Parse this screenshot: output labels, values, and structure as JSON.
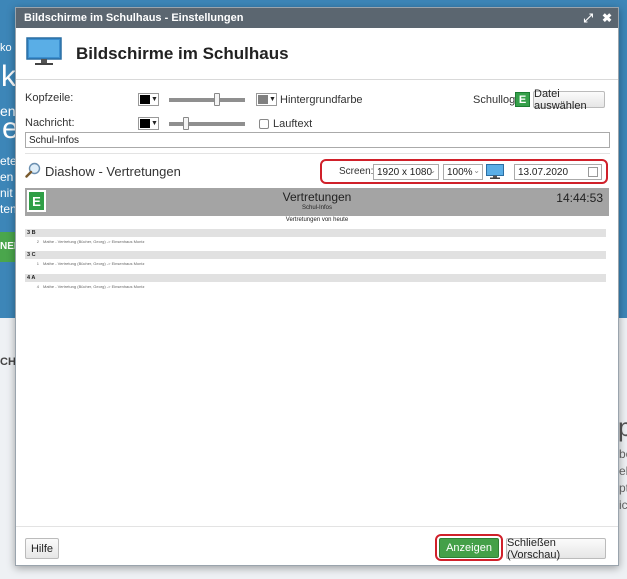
{
  "background": {
    "fragments": [
      {
        "id": "bg-ko",
        "text": "ko"
      },
      {
        "id": "bg-k",
        "text": "k"
      },
      {
        "id": "bg-en",
        "text": "en"
      },
      {
        "id": "bg-e",
        "text": "e"
      },
      {
        "id": "bg-er",
        "text": "er"
      },
      {
        "id": "bg-ete",
        "text": "ete"
      },
      {
        "id": "bg-en2",
        "text": "en"
      },
      {
        "id": "bg-nit",
        "text": "nit"
      },
      {
        "id": "bg-ten",
        "text": "ten"
      },
      {
        "id": "bg-ch",
        "text": "CH"
      },
      {
        "id": "bg-p",
        "text": "p"
      },
      {
        "id": "bg-be",
        "text": "be"
      },
      {
        "id": "bg-ek",
        "text": "ek"
      },
      {
        "id": "bg-pti",
        "text": "pti"
      },
      {
        "id": "bg-ic",
        "text": "ic"
      }
    ],
    "green_button": "NEN"
  },
  "dialog": {
    "window_title": "Bildschirme im Schulhaus - Einstellungen",
    "header_title": "Bildschirme im Schulhaus",
    "kopfzeile_label": "Kopfzeile:",
    "hintergrundfarbe_label": "Hintergrundfarbe",
    "schullogo_label": "Schullogo:",
    "datei_button": "Datei auswählen",
    "nachricht_label": "Nachricht:",
    "lauftext_label": "Lauftext",
    "message_value": "Schul-Infos",
    "kopfzeile_text_color": "#000000",
    "kopfzeile_bg_color": "#808080",
    "nachricht_color": "#000000",
    "kopfzeile_slider": 0.65,
    "hintergrund_slider": 0.18,
    "lauftext_checked": false
  },
  "diashow": {
    "title": "Diashow - Vertretungen",
    "screen_label": "Screen:",
    "resolution": "1920 x 1080",
    "zoom": "100%",
    "date": "13.07.2020"
  },
  "preview": {
    "title": "Vertretungen",
    "subtitle": "Schul-Infos",
    "time": "14:44:53",
    "caption": "Vertretungen von heute",
    "groups": [
      {
        "name": "3 B",
        "lines": [
          {
            "num": "2",
            "text": "Mathe - Vertretung (Bücher, Georg) -> Einsenhaus Montz"
          }
        ]
      },
      {
        "name": "3 C",
        "lines": [
          {
            "num": "1",
            "text": "Mathe - Vertretung (Bücher, Georg) -> Einsenhaus Montz"
          }
        ]
      },
      {
        "name": "4 A",
        "lines": [
          {
            "num": "4",
            "text": "Mathe - Vertretung (Bücher, Georg) -> Einsenhaus Montz"
          }
        ]
      }
    ]
  },
  "footer": {
    "help_button": "Hilfe",
    "show_button": "Anzeigen",
    "close_button": "Schließen (Vorschau)"
  }
}
